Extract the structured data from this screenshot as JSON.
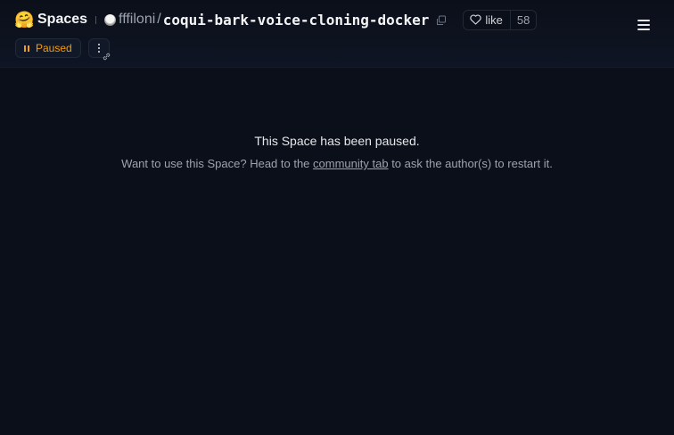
{
  "header": {
    "logo_emoji": "🤗",
    "spaces_label": "Spaces",
    "owner": "fffiloni",
    "separator": "/",
    "repo_name": "coqui-bark-voice-cloning-docker",
    "like_label": "like",
    "like_count": "58",
    "status_label": "Paused"
  },
  "main": {
    "title": "This Space has been paused.",
    "subtitle_before": "Want to use this Space? Head to the ",
    "subtitle_link": "community tab",
    "subtitle_after": " to ask the author(s) to restart it."
  },
  "colors": {
    "background": "#0b0f19",
    "status_accent": "#f59e0b"
  },
  "icons": [
    "hugging-face-logo",
    "avatar",
    "copy-icon",
    "heart-icon",
    "pause-icon",
    "more-icon",
    "link-icon",
    "hamburger-menu-icon"
  ]
}
